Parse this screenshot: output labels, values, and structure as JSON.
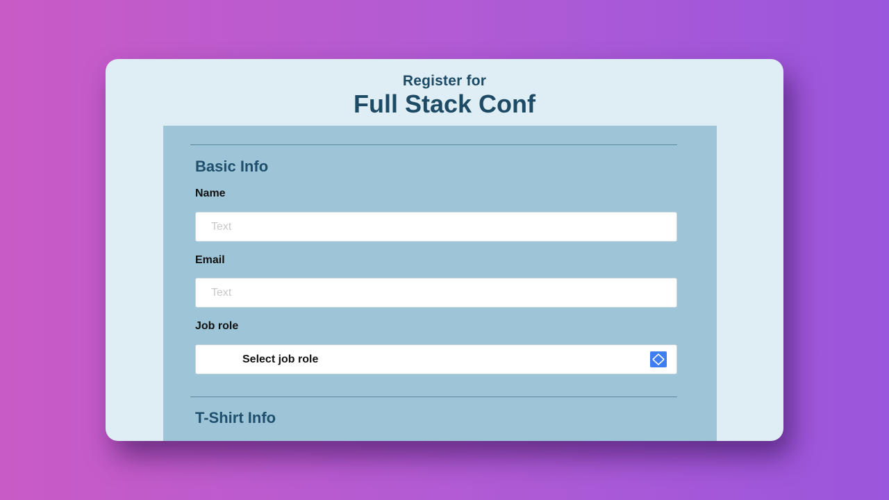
{
  "header": {
    "subtitle": "Register for",
    "title": "Full Stack Conf"
  },
  "basic_info": {
    "section_title": "Basic Info",
    "name_label": "Name",
    "name_placeholder": "Text",
    "email_label": "Email",
    "email_placeholder": "Text",
    "job_role_label": "Job role",
    "job_role_selected": "Select job role",
    "job_role_icon": "updown-chevron-icon"
  },
  "tshirt_info": {
    "section_title": "T-Shirt Info"
  },
  "colors": {
    "accent": "#3e7ef0",
    "heading": "#1d4a64",
    "panel": "#9dc5d7",
    "card": "#dfeef4"
  }
}
